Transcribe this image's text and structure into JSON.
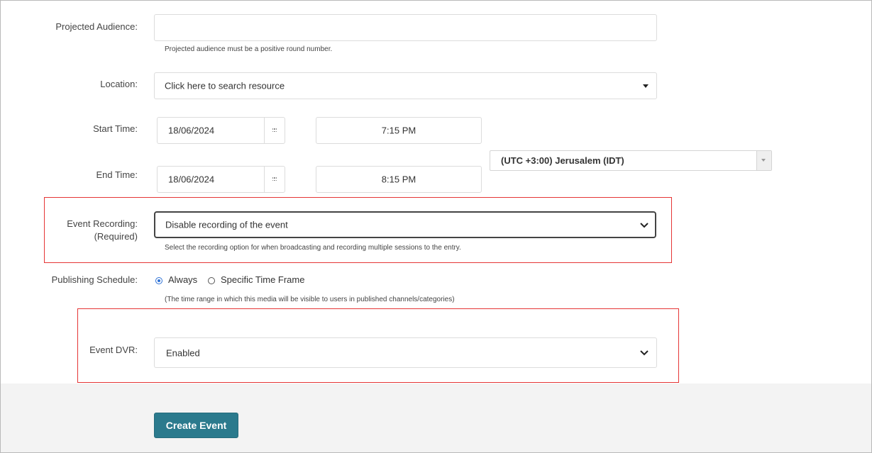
{
  "form": {
    "projected_audience": {
      "label": "Projected Audience:",
      "value": "",
      "help": "Projected audience must be a positive round number."
    },
    "location": {
      "label": "Location:",
      "placeholder": "Click here to search resource"
    },
    "start_time": {
      "label": "Start Time:",
      "date": "18/06/2024",
      "time": "7:15 PM"
    },
    "end_time": {
      "label": "End Time:",
      "date": "18/06/2024",
      "time": "8:15 PM"
    },
    "timezone": {
      "value": "(UTC +3:00) Jerusalem (IDT)"
    },
    "event_recording": {
      "label_line1": "Event Recording:",
      "label_line2": "(Required)",
      "value": "Disable recording of the event",
      "help": "Select the recording option for when broadcasting and recording multiple sessions to the entry."
    },
    "publishing_schedule": {
      "label": "Publishing Schedule:",
      "options": [
        "Always",
        "Specific Time Frame"
      ],
      "selected": "Always",
      "help": "(The time range in which this media will be visible to users in published channels/categories)"
    },
    "event_dvr": {
      "label": "Event DVR:",
      "value": "Enabled"
    },
    "submit": {
      "label": "Create Event"
    }
  },
  "colors": {
    "accent_button": "#2b7a8d",
    "highlight_border": "#e53535",
    "radio_selected": "#2f72d6"
  }
}
